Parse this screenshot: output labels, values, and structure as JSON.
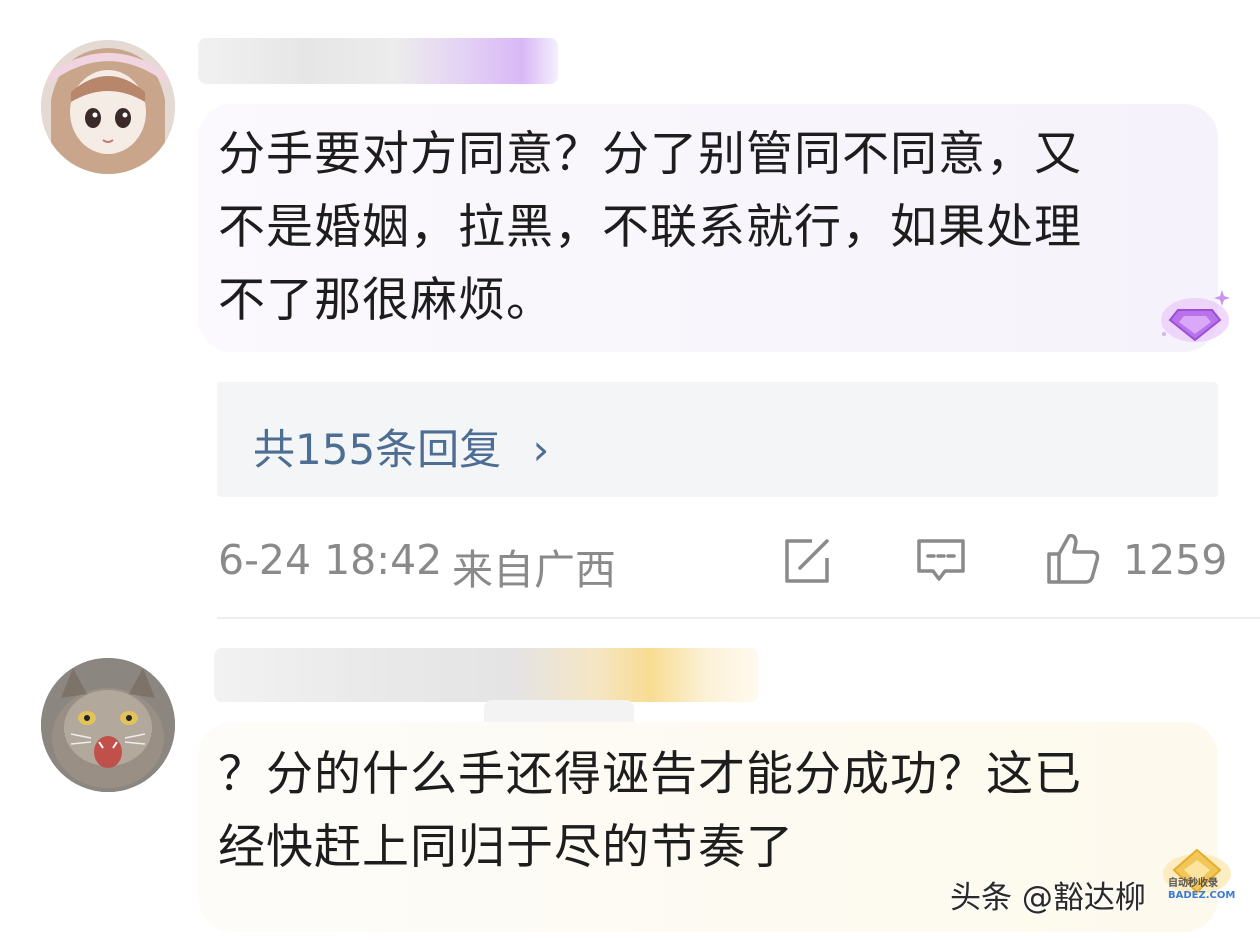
{
  "comments": [
    {
      "text_lines": [
        "分手要对方同意？分了别管同不同意，又",
        "不是婚姻，拉黑，不联系就行，如果处理",
        "不了那很麻烦。"
      ],
      "replies_label": "共155条回复",
      "replies_chevron": "›",
      "timestamp": "6-24 18:42",
      "location": "来自广西",
      "like_count": "1259",
      "icons": [
        "share-icon",
        "comment-icon",
        "thumbs-up-icon",
        "diamond-badge-icon"
      ]
    },
    {
      "text_lines": [
        "？分的什么手还得诬告才能分成功？这已",
        "经快赶上同归于尽的节奏了"
      ],
      "icons": [
        "gold-badge-icon"
      ]
    }
  ],
  "watermark": {
    "text": "头条 @豁达柳",
    "badge_lines": [
      "自动秒收录",
      "BADEZ.COM"
    ]
  },
  "colors": {
    "link_blue": "#4d6d93",
    "meta_gray": "#8a8a8a",
    "bubble_purple": "#f6f2fb",
    "bubble_cream": "#fdf9ec"
  }
}
